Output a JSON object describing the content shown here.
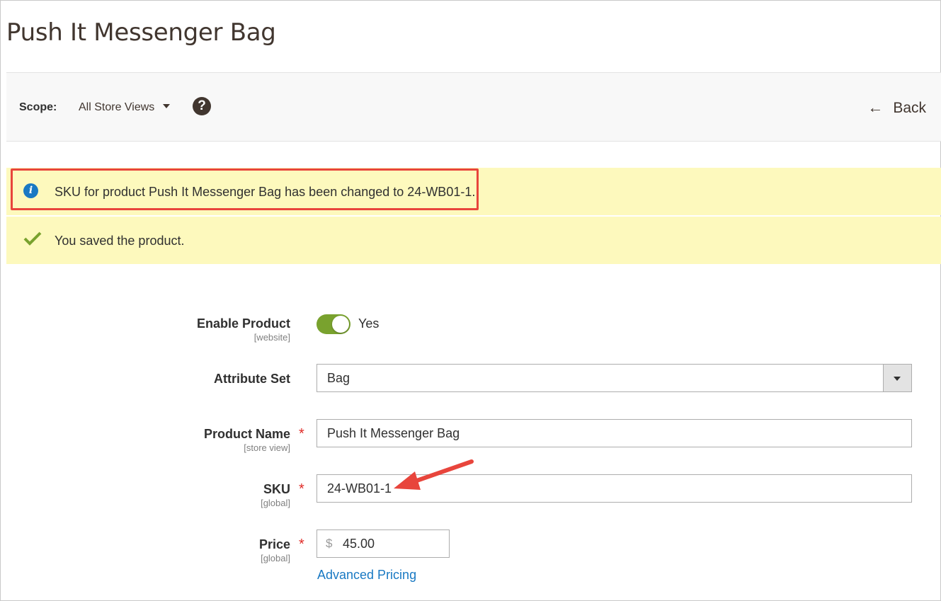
{
  "page": {
    "title": "Push It Messenger Bag"
  },
  "scope_bar": {
    "label": "Scope:",
    "selected": "All Store Views",
    "help_glyph": "?",
    "back_label": "Back",
    "back_glyph": "←"
  },
  "messages": {
    "info": "SKU for product Push It Messenger Bag has been changed to 24-WB01-1.",
    "success": "You saved the product.",
    "info_glyph": "i"
  },
  "form": {
    "enable_product": {
      "label": "Enable Product",
      "scope": "[website]",
      "value": "Yes",
      "enabled": true
    },
    "attribute_set": {
      "label": "Attribute Set",
      "value": "Bag"
    },
    "product_name": {
      "label": "Product Name",
      "scope": "[store view]",
      "value": "Push It Messenger Bag",
      "required": "*"
    },
    "sku": {
      "label": "SKU",
      "scope": "[global]",
      "value": "24-WB01-1",
      "required": "*"
    },
    "price": {
      "label": "Price",
      "scope": "[global]",
      "currency": "$",
      "value": "45.00",
      "required": "*"
    },
    "advanced_pricing": "Advanced Pricing"
  },
  "colors": {
    "notice_bg": "#fdf9bd",
    "highlight": "#e8453c",
    "link": "#1979c3",
    "toggle_on": "#79a22e",
    "required": "#e02b27"
  },
  "icons": {
    "help": "help-icon",
    "back": "back-arrow-icon",
    "info": "info-icon",
    "success": "check-icon",
    "annotation": "red-arrow-icon"
  }
}
